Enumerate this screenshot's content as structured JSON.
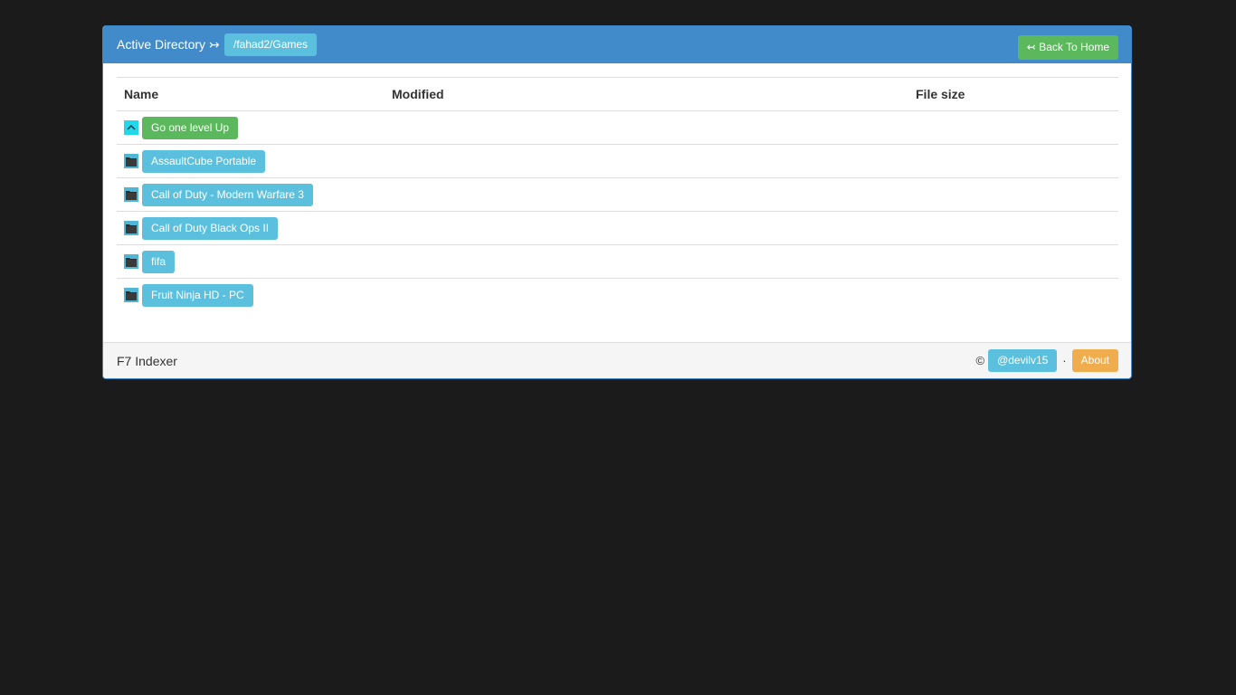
{
  "header": {
    "title": "Active Directory ↣",
    "path": "/fahad2/Games",
    "back_button": "↢ Back To Home"
  },
  "table": {
    "columns": [
      "Name",
      "Modified",
      "File size"
    ],
    "up_row": {
      "label": "Go one level Up",
      "icon": "arrow-up-icon"
    },
    "rows": [
      {
        "name": "AssaultCube Portable",
        "icon": "folder-icon"
      },
      {
        "name": "Call of Duty - Modern Warfare 3",
        "icon": "folder-icon"
      },
      {
        "name": "Call of Duty Black Ops II",
        "icon": "folder-icon"
      },
      {
        "name": "fifa",
        "icon": "folder-icon"
      },
      {
        "name": "Fruit Ninja HD - PC",
        "icon": "folder-icon"
      }
    ]
  },
  "footer": {
    "title": "F7 Indexer",
    "copyright": "©",
    "author": "@devilv15",
    "separator": "·",
    "about": "About"
  },
  "colors": {
    "primary": "#428bca",
    "info": "#5bc0de",
    "success": "#5cb85c",
    "warning": "#f0ad4e",
    "background": "#1b1b1b"
  }
}
